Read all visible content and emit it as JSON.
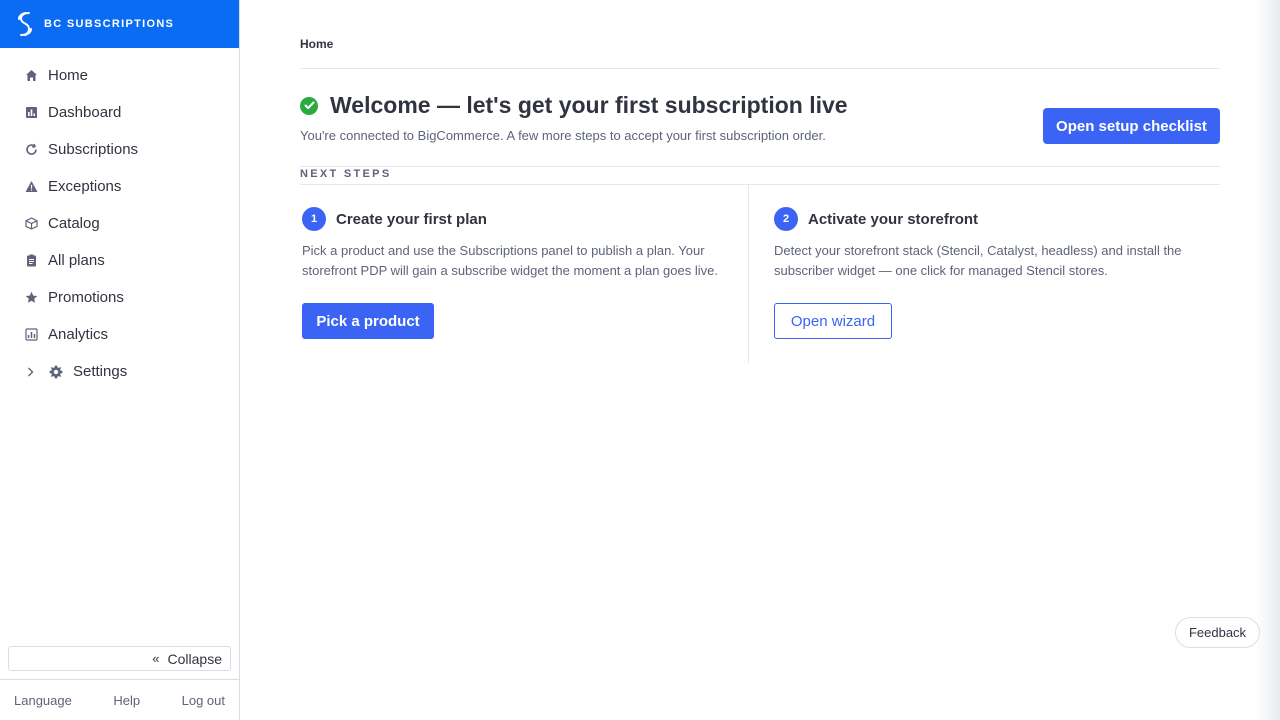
{
  "app": {
    "name": "BC SUBSCRIPTIONS"
  },
  "colors": {
    "brand": "#0a6cf2",
    "primary": "#3c64f4",
    "success": "#2aab3f",
    "text": "#313440",
    "muted": "#5e637a"
  },
  "sidebar": {
    "items": [
      {
        "label": "Home",
        "icon": "home-icon"
      },
      {
        "label": "Dashboard",
        "icon": "dashboard-icon"
      },
      {
        "label": "Subscriptions",
        "icon": "refresh-icon"
      },
      {
        "label": "Exceptions",
        "icon": "warning-icon"
      },
      {
        "label": "Catalog",
        "icon": "box-icon"
      },
      {
        "label": "All plans",
        "icon": "clipboard-icon"
      },
      {
        "label": "Promotions",
        "icon": "star-icon"
      },
      {
        "label": "Analytics",
        "icon": "chart-icon"
      }
    ],
    "settings": {
      "label": "Settings",
      "icon": "gear-icon"
    },
    "collapse": {
      "arrow": "«",
      "label": "Collapse"
    },
    "footer": {
      "language": "Language",
      "help": "Help",
      "logout": "Log out"
    }
  },
  "main": {
    "breadcrumb": "Home",
    "welcome": {
      "title": "Welcome — let's get your first subscription live",
      "subtitle": "You're connected to BigCommerce. A few more steps to accept your first subscription order.",
      "checklist_button": "Open setup checklist"
    },
    "next_steps_label": "NEXT STEPS",
    "steps": [
      {
        "number": "1",
        "title": "Create your first plan",
        "description": "Pick a product and use the Subscriptions panel to publish a plan. Your storefront PDP will gain a subscribe widget the moment a plan goes live.",
        "button": "Pick a product"
      },
      {
        "number": "2",
        "title": "Activate your storefront",
        "description": "Detect your storefront stack (Stencil, Catalyst, headless) and install the subscriber widget — one click for managed Stencil stores.",
        "button": "Open wizard"
      }
    ],
    "feedback": "Feedback"
  }
}
